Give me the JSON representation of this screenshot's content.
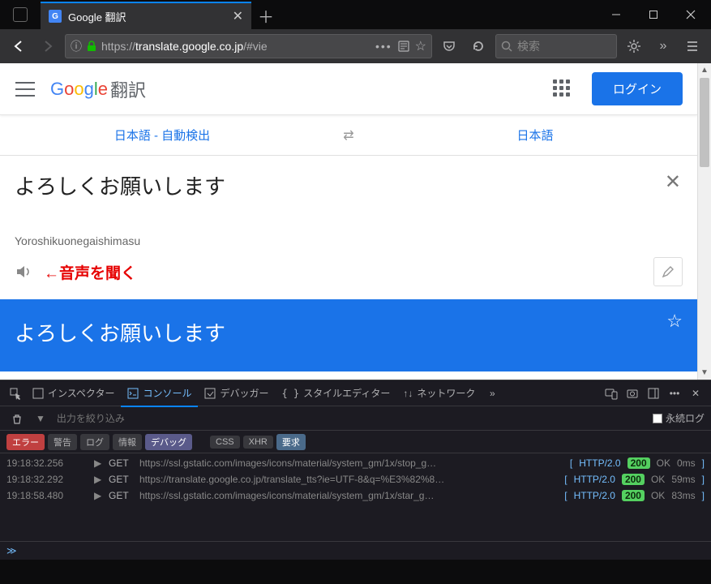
{
  "window": {
    "tab_title": "Google 翻訳",
    "url_prefix": "https://",
    "url_host": "translate.google.co.jp",
    "url_path": "/#vie",
    "search_placeholder": "検索"
  },
  "page": {
    "logo_suffix": "翻訳",
    "login_label": "ログイン",
    "source_lang": "日本語 - 自動検出",
    "target_lang": "日本語",
    "input_text": "よろしくお願いします",
    "romaji": "Yoroshikuonegaishimasu",
    "annotation": "←音声を聞く",
    "output_text": "よろしくお願いします"
  },
  "devtools": {
    "tabs": {
      "inspector": "インスペクター",
      "console": "コンソール",
      "debugger": "デバッガー",
      "style": "スタイルエディター",
      "network": "ネットワーク"
    },
    "filter_placeholder": "出力を絞り込み",
    "persist_label": "永続ログ",
    "badges": {
      "error": "エラー",
      "warn": "警告",
      "log": "ログ",
      "info": "情報",
      "debug": "デバッグ",
      "css": "CSS",
      "xhr": "XHR",
      "req": "要求"
    },
    "logs": [
      {
        "time": "19:18:32.256",
        "method": "GET",
        "url": "https://ssl.gstatic.com/images/icons/material/system_gm/1x/stop_g…",
        "proto": "HTTP/2.0",
        "status": "200",
        "ok": "OK",
        "timing": "0ms",
        "hl": false
      },
      {
        "time": "19:18:32.292",
        "method": "GET",
        "url": "https://translate.google.co.jp/translate_tts?ie=UTF-8&q=%E3%82%8…",
        "proto": "HTTP/2.0",
        "status": "200",
        "ok": "OK",
        "timing": "59ms",
        "hl": true
      },
      {
        "time": "19:18:58.480",
        "method": "GET",
        "url": "https://ssl.gstatic.com/images/icons/material/system_gm/1x/star_g…",
        "proto": "HTTP/2.0",
        "status": "200",
        "ok": "OK",
        "timing": "83ms",
        "hl": false
      }
    ]
  }
}
